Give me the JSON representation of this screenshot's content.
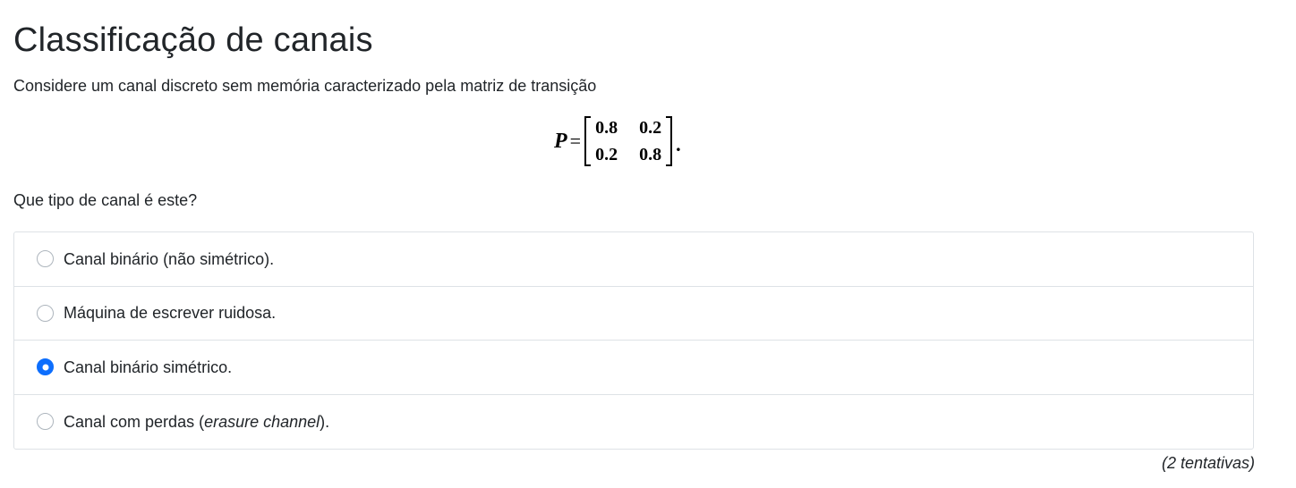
{
  "page": {
    "title": "Classificação de canais",
    "prompt": "Considere um canal discreto sem memória caracterizado pela matriz de transição",
    "question": "Que tipo de canal é este?",
    "attempts": "(2 tentativas)"
  },
  "equation": {
    "variable": "P",
    "equals": "=",
    "matrix": [
      [
        "0.8",
        "0.2"
      ],
      [
        "0.2",
        "0.8"
      ]
    ],
    "terminator": "."
  },
  "options": [
    {
      "label": "Canal binário (não simétrico).",
      "selected": false
    },
    {
      "label": "Máquina de escrever ruidosa.",
      "selected": false
    },
    {
      "label": "Canal binário simétrico.",
      "selected": true
    },
    {
      "label_before": "Canal com perdas (",
      "label_emphasis": "erasure channel",
      "label_after": ").",
      "selected": false
    }
  ],
  "colors": {
    "accent": "#0d6efd",
    "border": "#dee2e6",
    "text": "#212529"
  }
}
